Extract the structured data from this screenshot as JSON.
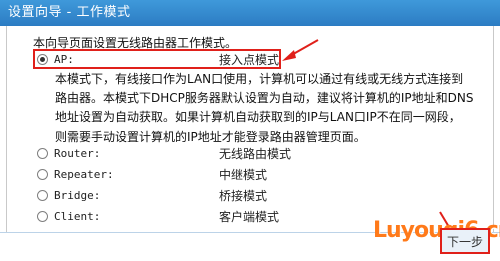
{
  "window": {
    "title": "设置向导 - 工作模式"
  },
  "intro": "本向导页面设置无线路由器工作模式。",
  "options": [
    {
      "code": "AP:",
      "name": "接入点模式",
      "selected": true
    },
    {
      "code": "Router:",
      "name": "无线路由模式",
      "selected": false
    },
    {
      "code": "Repeater:",
      "name": "中继模式",
      "selected": false
    },
    {
      "code": "Bridge:",
      "name": "桥接模式",
      "selected": false
    },
    {
      "code": "Client:",
      "name": "客户端模式",
      "selected": false
    }
  ],
  "ap_description": [
    "本模式下，有线接口作为LAN口使用，计算机可以通过有线或无线方式连接到",
    "路由器。本模式下DHCP服务器默认设置为自动，建议将计算机的IP地址和DNS",
    "地址设置为自动获取。如果计算机自动获取到的IP与LAN口IP不在同一网段，",
    "则需要手动设置计算机的IP地址才能登录路由器管理页面。"
  ],
  "next_button": "下一步",
  "watermark": "Luyouqi6.cn",
  "colors": {
    "titlebar": "#2c7cc3",
    "highlight": "#e0201a",
    "watermark": "#ff7a1a"
  }
}
